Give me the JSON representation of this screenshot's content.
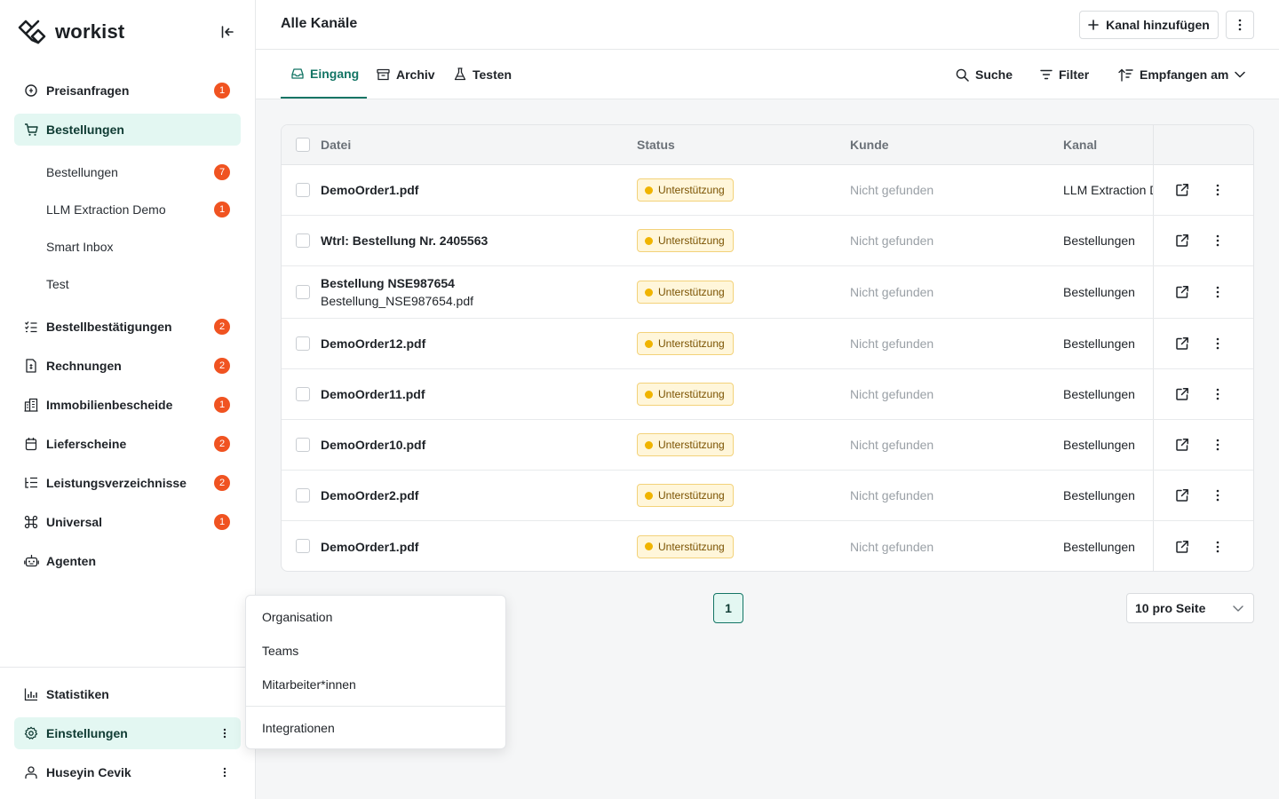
{
  "app": {
    "logo_text": "workist"
  },
  "sidebar": {
    "nav": [
      {
        "label": "Preisanfragen",
        "badge": "1",
        "icon": "quote-icon"
      },
      {
        "label": "Bestellungen",
        "icon": "cart-icon",
        "active": true
      },
      {
        "label": "Bestellbestätigungen",
        "badge": "2",
        "icon": "checklist-icon"
      },
      {
        "label": "Rechnungen",
        "badge": "2",
        "icon": "invoice-icon"
      },
      {
        "label": "Immobilienbescheide",
        "badge": "1",
        "icon": "building-icon"
      },
      {
        "label": "Lieferscheine",
        "badge": "2",
        "icon": "box-icon"
      },
      {
        "label": "Leistungsverzeichnisse",
        "badge": "2",
        "icon": "list-tree-icon"
      },
      {
        "label": "Universal",
        "badge": "1",
        "icon": "command-icon"
      },
      {
        "label": "Agenten",
        "icon": "robot-icon"
      }
    ],
    "sub": [
      {
        "label": "Bestellungen",
        "badge": "7"
      },
      {
        "label": "LLM Extraction Demo",
        "badge": "1"
      },
      {
        "label": "Smart Inbox"
      },
      {
        "label": "Test"
      }
    ],
    "bottom": {
      "statistiken": "Statistiken",
      "einstellungen": "Einstellungen",
      "user": "Huseyin Cevik"
    }
  },
  "header": {
    "title": "Alle Kanäle",
    "add_channel": "Kanal hinzufügen"
  },
  "tabs": {
    "eingang": "Eingang",
    "archiv": "Archiv",
    "testen": "Testen"
  },
  "tools": {
    "suche": "Suche",
    "filter": "Filter",
    "sort": "Empfangen am"
  },
  "table": {
    "columns": {
      "datei": "Datei",
      "status": "Status",
      "kunde": "Kunde",
      "kanal": "Kanal"
    },
    "rows": [
      {
        "file": "DemoOrder1.pdf",
        "status": "Unterstützung",
        "kunde": "Nicht gefunden",
        "kanal": "LLM Extraction Demo"
      },
      {
        "file": "Wtrl: Bestellung Nr. 2405563",
        "status": "Unterstützung",
        "kunde": "Nicht gefunden",
        "kanal": "Bestellungen"
      },
      {
        "file": "Bestellung NSE987654",
        "file_sub": "Bestellung_NSE987654.pdf",
        "status": "Unterstützung",
        "kunde": "Nicht gefunden",
        "kanal": "Bestellungen"
      },
      {
        "file": "DemoOrder12.pdf",
        "status": "Unterstützung",
        "kunde": "Nicht gefunden",
        "kanal": "Bestellungen"
      },
      {
        "file": "DemoOrder11.pdf",
        "status": "Unterstützung",
        "kunde": "Nicht gefunden",
        "kanal": "Bestellungen"
      },
      {
        "file": "DemoOrder10.pdf",
        "status": "Unterstützung",
        "kunde": "Nicht gefunden",
        "kanal": "Bestellungen"
      },
      {
        "file": "DemoOrder2.pdf",
        "status": "Unterstützung",
        "kunde": "Nicht gefunden",
        "kanal": "Bestellungen"
      },
      {
        "file": "DemoOrder1.pdf",
        "status": "Unterstützung",
        "kunde": "Nicht gefunden",
        "kanal": "Bestellungen"
      }
    ]
  },
  "pagination": {
    "current_page": "1",
    "page_size": "10 pro Seite"
  },
  "popup_menu": {
    "items": [
      "Organisation",
      "Teams",
      "Mitarbeiter*innen"
    ],
    "integrationen": "Integrationen"
  },
  "colors": {
    "accent": "#137565",
    "active_bg": "#e3f7f2",
    "badge": "#f05321",
    "status_bg": "#fff6da",
    "status_dot": "#f0b400"
  }
}
